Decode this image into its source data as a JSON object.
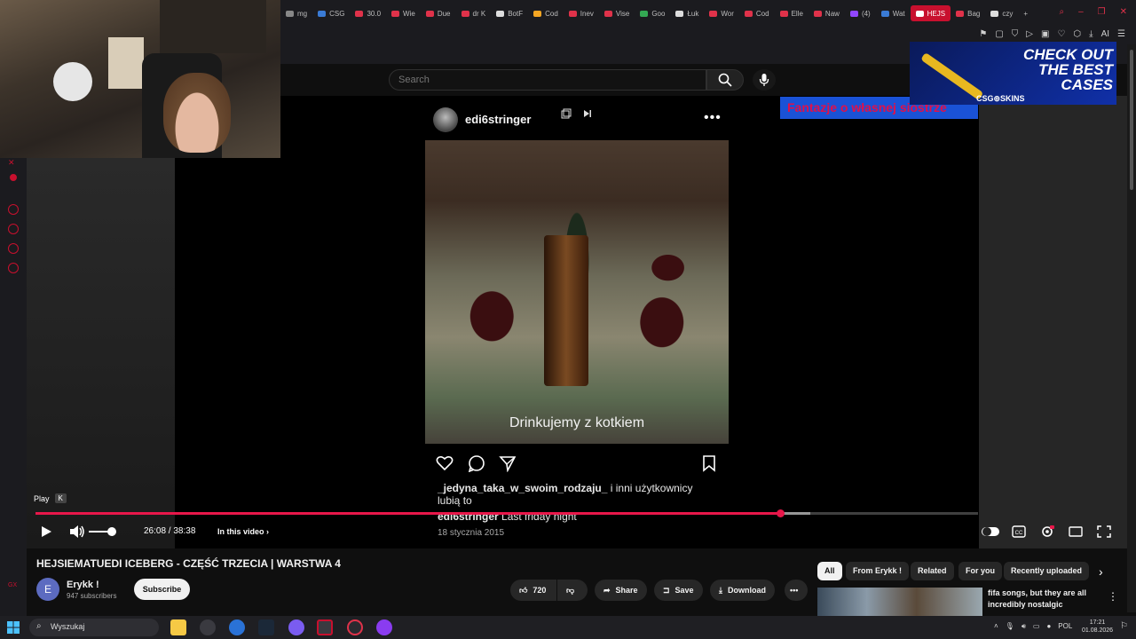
{
  "browser": {
    "tabs": [
      {
        "label": "mg",
        "color": "#888888"
      },
      {
        "label": "CSG",
        "color": "#3a7bd5"
      },
      {
        "label": "30.0",
        "color": "#e0324a"
      },
      {
        "label": "Wie",
        "color": "#e0324a"
      },
      {
        "label": "Due",
        "color": "#e0324a"
      },
      {
        "label": "dr K",
        "color": "#e0324a"
      },
      {
        "label": "BotF",
        "color": "#dddddd"
      },
      {
        "label": "Cod",
        "color": "#f5a623"
      },
      {
        "label": "Inev",
        "color": "#e0324a"
      },
      {
        "label": "Vise",
        "color": "#e0324a"
      },
      {
        "label": "Goo",
        "color": "#34a853"
      },
      {
        "label": "Łuk",
        "color": "#dddddd"
      },
      {
        "label": "Wor",
        "color": "#e0324a"
      },
      {
        "label": "Cod",
        "color": "#e0324a"
      },
      {
        "label": "Elle",
        "color": "#e0324a"
      },
      {
        "label": "Naw",
        "color": "#e0324a"
      },
      {
        "label": "(4) ",
        "color": "#9146ff"
      },
      {
        "label": "Wat",
        "color": "#3a7bd5"
      },
      {
        "label": "HEJS",
        "color": "#ffffff",
        "active": true
      },
      {
        "label": "Bag",
        "color": "#e0324a"
      },
      {
        "label": "czy",
        "color": "#dddddd"
      }
    ],
    "new_tab": "+"
  },
  "youtube": {
    "search_placeholder": "Search"
  },
  "post": {
    "username": "edi6stringer",
    "caption_overlay": "Drinkujemy z kotkiem",
    "likes_user": "_jedyna_taka_w_swoim_rodzaju_",
    "likes_rest": " i inni użytkownicy",
    "likes_line2": "lubią to",
    "caption_user": "edi6stringer",
    "caption_text": " Last friday night",
    "date": "18 stycznia 2015"
  },
  "ads": {
    "red_banner": "Fantazje o własnej siostrze",
    "csgo_headline": "CHECK OUT THE BEST CASES",
    "csgo_brand": "CSG⊚SKINS"
  },
  "player": {
    "tooltip_label": "Play",
    "tooltip_key": "K",
    "time": "26:08 / 38:38",
    "chapters": "In this video",
    "progress": 0.7898,
    "buffered": 0.822
  },
  "video": {
    "title": "HEJSIEMATUEDI ICEBERG - CZĘŚĆ TRZECIA | WARSTWA 4",
    "channel": "Erykk !",
    "channel_initial": "E",
    "subscribers": "947 subscribers",
    "subscribe": "Subscribe",
    "likes": "720",
    "share": "Share",
    "save": "Save",
    "download": "Download"
  },
  "chips": [
    "All",
    "From Erykk !",
    "Related",
    "For you",
    "Recently uploaded"
  ],
  "recommendation": {
    "title": "fifa songs, but they are all incredibly nostalgic"
  },
  "taskbar": {
    "search": "Wyszukaj",
    "lang": "POL",
    "time": "17:21",
    "date": "01.08.2026"
  }
}
